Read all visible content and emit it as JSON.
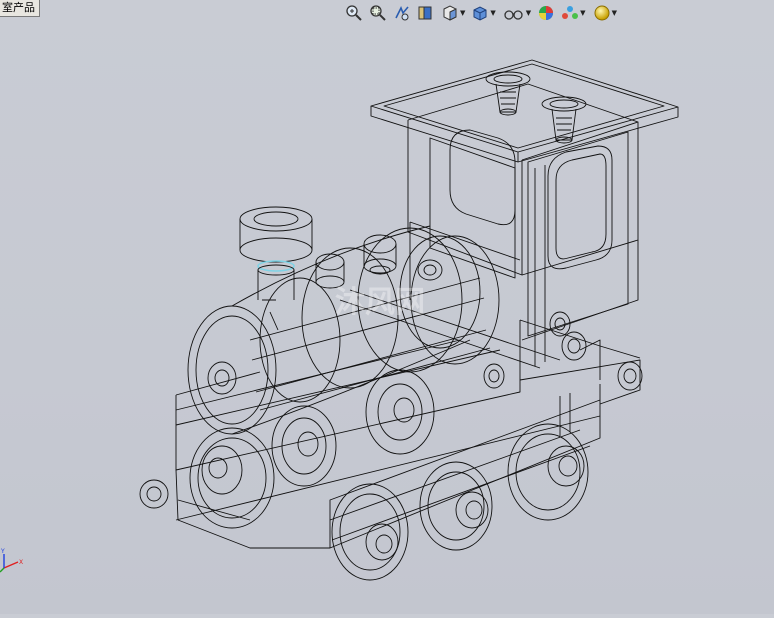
{
  "feature_tree": {
    "tab_label": "室产品"
  },
  "toolbar": {
    "buttons": [
      {
        "name": "zoom-to-fit-icon"
      },
      {
        "name": "zoom-to-area-icon"
      },
      {
        "name": "previous-view-icon"
      },
      {
        "name": "section-view-icon"
      },
      {
        "name": "view-orientation-icon",
        "dropdown": true
      },
      {
        "name": "display-style-icon",
        "dropdown": true
      },
      {
        "name": "hide-show-items-icon",
        "dropdown": true
      },
      {
        "name": "edit-appearance-icon"
      },
      {
        "name": "apply-scene-icon",
        "dropdown": true
      },
      {
        "name": "view-settings-icon",
        "dropdown": true
      }
    ]
  },
  "viewport": {
    "model": "steam-locomotive-wireframe",
    "watermark": "沐风网"
  },
  "triad": {
    "x_label": "X",
    "y_label": "Y"
  },
  "colors": {
    "background": "#c8cbd3",
    "edges": "#111111",
    "highlight": "#7fd3e6"
  }
}
